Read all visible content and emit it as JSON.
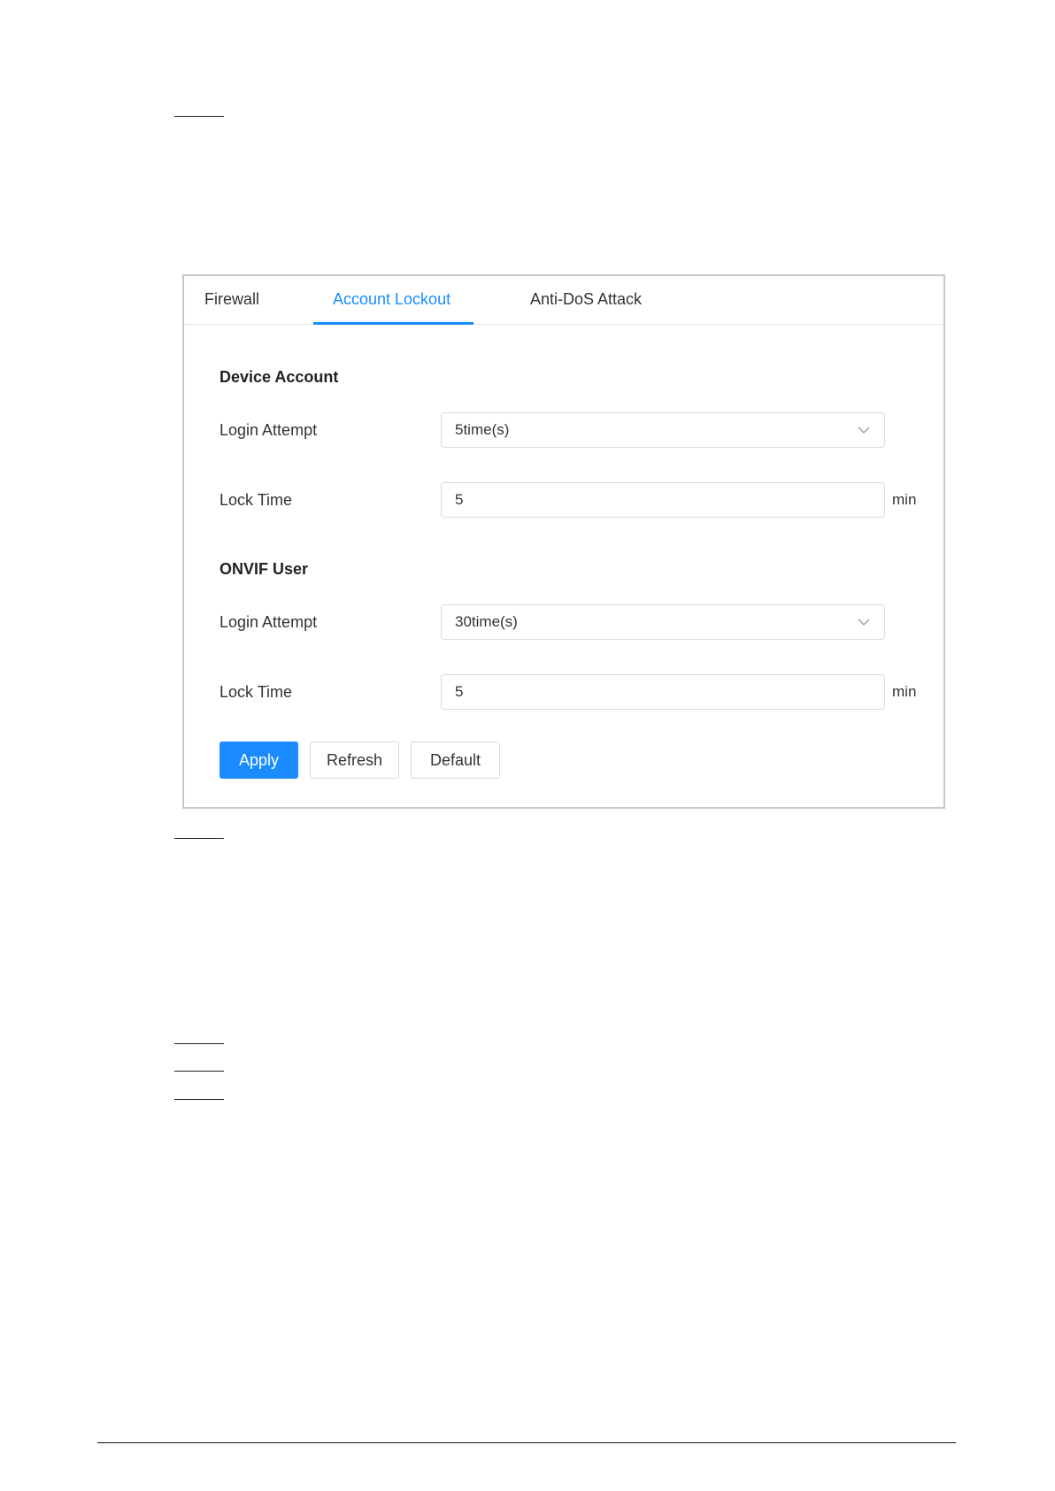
{
  "tabs": [
    {
      "label": "Firewall",
      "active": false
    },
    {
      "label": "Account Lockout",
      "active": true
    },
    {
      "label": "Anti-DoS Attack",
      "active": false
    }
  ],
  "device_account": {
    "title": "Device Account",
    "login_attempt_label": "Login Attempt",
    "login_attempt_value": "5time(s)",
    "lock_time_label": "Lock Time",
    "lock_time_value": "5",
    "lock_time_unit": "min"
  },
  "onvif_user": {
    "title": "ONVIF User",
    "login_attempt_label": "Login Attempt",
    "login_attempt_value": "30time(s)",
    "lock_time_label": "Lock Time",
    "lock_time_value": "5",
    "lock_time_unit": "min"
  },
  "buttons": {
    "apply": "Apply",
    "refresh": "Refresh",
    "default": "Default"
  },
  "colors": {
    "accent": "#1a8cff",
    "border": "#d9d9d9"
  },
  "icons": {
    "dropdown": "chevron-down-icon"
  }
}
